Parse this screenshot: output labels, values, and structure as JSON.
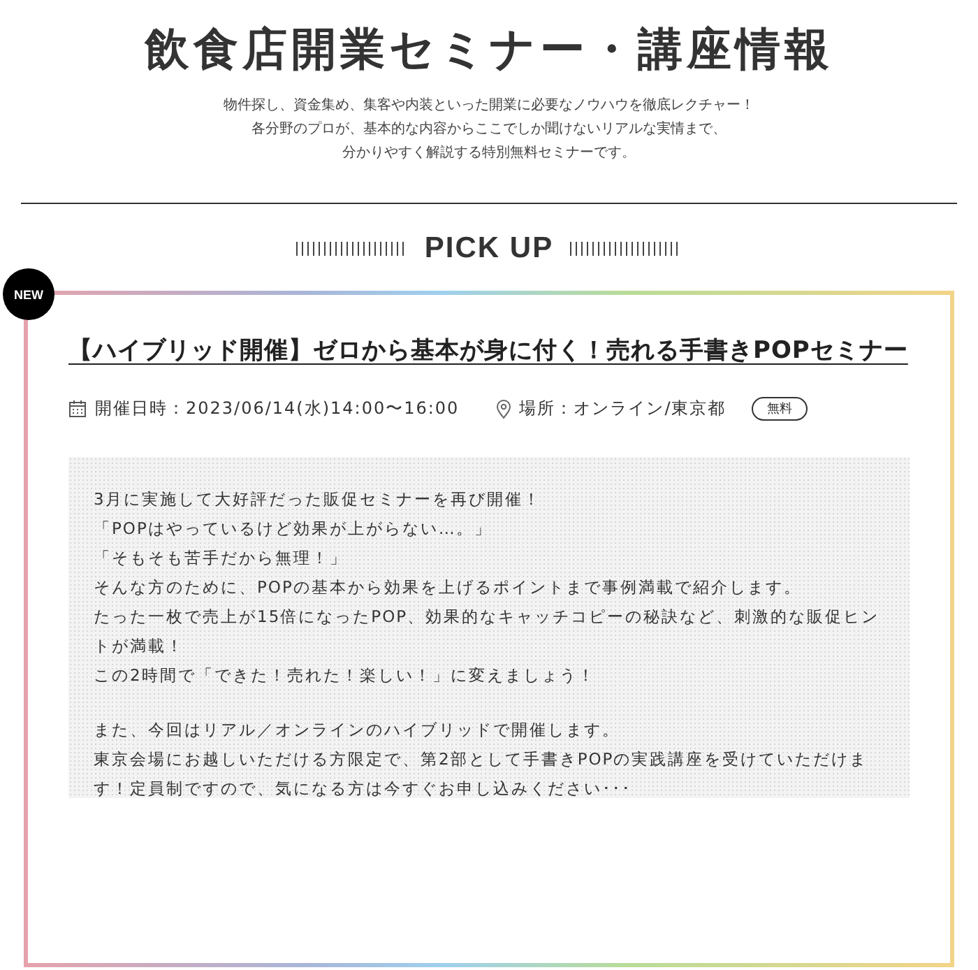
{
  "header": {
    "title": "飲食店開業セミナー・講座情報",
    "intro": [
      "物件探し、資金集め、集客や内装といった開業に必要なノウハウを徹底レクチャー！",
      "各分野のプロが、基本的な内容からここでしか聞けないリアルな実情まで、",
      "分かりやすく解説する特別無料セミナーです。"
    ]
  },
  "section": {
    "heading": "PICK UP"
  },
  "seminar": {
    "badge": "NEW",
    "title": "【ハイブリッド開催】ゼロから基本が身に付く！売れる手書きPOPセミナー",
    "date": "開催日時：2023/06/14(水)14:00〜16:00",
    "place": "場所：オンライン/東京都",
    "price_tag": "無料",
    "description": [
      [
        "3月に実施して大好評だった販促セミナーを再び開催！",
        "「POPはやっているけど効果が上がらない…。」",
        "「そもそも苦手だから無理！」",
        "そんな方のために、POPの基本から効果を上げるポイントまで事例満載で紹介します。",
        "たった一枚で売上が15倍になったPOP、効果的なキャッチコピーの秘訣など、刺激的な販促ヒントが満載！",
        "この2時間で「できた！売れた！楽しい！」に変えましょう！"
      ],
      [
        "また、今回はリアル／オンラインのハイブリッドで開催します。",
        "東京会場にお越しいただける方限定で、第2部として手書きPOPの実践講座を受けていただけます！定員制ですので、気になる方は今すぐお申し込みください･･･"
      ]
    ]
  }
}
